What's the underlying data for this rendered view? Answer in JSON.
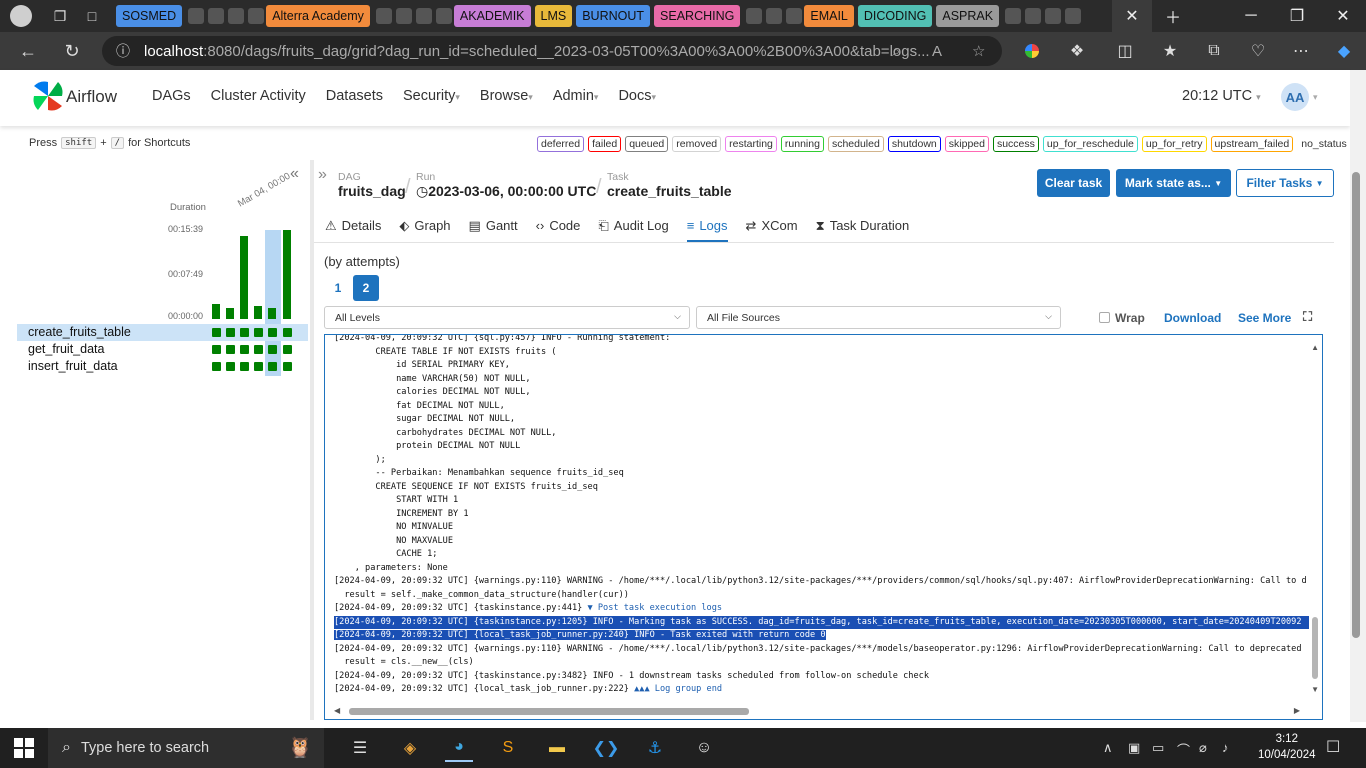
{
  "browser": {
    "bookmarks": [
      {
        "label": "SOSMED",
        "color": "#4a8fe7"
      },
      {
        "label": "Alterra Academy",
        "color": "#f28b3c"
      },
      {
        "label": "AKADEMIK",
        "color": "#c77dd6"
      },
      {
        "label": "LMS",
        "color": "#e8b93a"
      },
      {
        "label": "BURNOUT",
        "color": "#4a8fe7"
      },
      {
        "label": "SEARCHING",
        "color": "#e86aa8"
      },
      {
        "label": "EMAIL",
        "color": "#f28b3c"
      },
      {
        "label": "DICODING",
        "color": "#52c0b4"
      },
      {
        "label": "ASPRAK",
        "color": "#9a9a9a"
      }
    ],
    "url_host": "localhost",
    "url_rest": ":8080/dags/fruits_dag/grid?dag_run_id=scheduled__2023-03-05T00%3A00%3A00%2B00%3A00&tab=logs..."
  },
  "airflow": {
    "brand": "Airflow",
    "menu": [
      {
        "label": "DAGs",
        "dropdown": false
      },
      {
        "label": "Cluster Activity",
        "dropdown": false
      },
      {
        "label": "Datasets",
        "dropdown": false
      },
      {
        "label": "Security",
        "dropdown": true
      },
      {
        "label": "Browse",
        "dropdown": true
      },
      {
        "label": "Admin",
        "dropdown": true
      },
      {
        "label": "Docs",
        "dropdown": true
      }
    ],
    "clock": "20:12 UTC",
    "avatar": "AA",
    "shortcut": {
      "press": "Press",
      "key1": "shift",
      "plus": "+",
      "key2": "/",
      "suffix": "for Shortcuts"
    },
    "legend": [
      {
        "label": "deferred",
        "color": "#9370db"
      },
      {
        "label": "failed",
        "color": "#ff0000"
      },
      {
        "label": "queued",
        "color": "#808080"
      },
      {
        "label": "removed",
        "color": "#d3d3d3"
      },
      {
        "label": "restarting",
        "color": "#ee82ee"
      },
      {
        "label": "running",
        "color": "#32cd32"
      },
      {
        "label": "scheduled",
        "color": "#d2b48c"
      },
      {
        "label": "shutdown",
        "color": "#0000ff"
      },
      {
        "label": "skipped",
        "color": "#ff69b4"
      },
      {
        "label": "success",
        "color": "#008000"
      },
      {
        "label": "up_for_reschedule",
        "color": "#40e0d0"
      },
      {
        "label": "up_for_retry",
        "color": "#ffd700"
      },
      {
        "label": "upstream_failed",
        "color": "#ffa500"
      },
      {
        "label": "no_status",
        "color": "#ffffff"
      }
    ],
    "grid": {
      "duration_label": "Duration",
      "date_label": "Mar 04, 00:00",
      "yticks": [
        "00:15:39",
        "00:07:49",
        "00:00:00"
      ],
      "tasks": [
        "create_fruits_table",
        "get_fruit_data",
        "insert_fruit_data"
      ],
      "selected_task": "create_fruits_table"
    },
    "breadcrumb": {
      "dag_label": "DAG",
      "dag_value": "fruits_dag",
      "run_label": "Run",
      "run_value": "2023-03-06, 00:00:00 UTC",
      "task_label": "Task",
      "task_value": "create_fruits_table"
    },
    "buttons": {
      "clear": "Clear task",
      "mark": "Mark state as...",
      "filter": "Filter Tasks"
    },
    "tabs": [
      {
        "label": "Details",
        "icon": "warning-icon"
      },
      {
        "label": "Graph",
        "icon": "graph-icon"
      },
      {
        "label": "Gantt",
        "icon": "gantt-icon"
      },
      {
        "label": "Code",
        "icon": "code-icon"
      },
      {
        "label": "Audit Log",
        "icon": "audit-icon"
      },
      {
        "label": "Logs",
        "icon": "list-icon",
        "active": true
      },
      {
        "label": "XCom",
        "icon": "exchange-icon"
      },
      {
        "label": "Task Duration",
        "icon": "hourglass-icon"
      }
    ],
    "attempts_label": "(by attempts)",
    "attempts": [
      "1",
      "2"
    ],
    "active_attempt": "2",
    "levels_select": "All Levels",
    "sources_select": "All File Sources",
    "wrap_label": "Wrap",
    "download_label": "Download",
    "see_more_label": "See More",
    "log_lines": [
      {
        "text": "[2024-04-09, 20:09:32 UTC] {sql.py:457} INFO - Running statement:"
      },
      {
        "text": "        CREATE TABLE IF NOT EXISTS fruits ("
      },
      {
        "text": "            id SERIAL PRIMARY KEY,"
      },
      {
        "text": "            name VARCHAR(50) NOT NULL,"
      },
      {
        "text": "            calories DECIMAL NOT NULL,"
      },
      {
        "text": "            fat DECIMAL NOT NULL,"
      },
      {
        "text": "            sugar DECIMAL NOT NULL,"
      },
      {
        "text": "            carbohydrates DECIMAL NOT NULL,"
      },
      {
        "text": "            protein DECIMAL NOT NULL"
      },
      {
        "text": "        );"
      },
      {
        "text": "        -- Perbaikan: Menambahkan sequence fruits_id_seq"
      },
      {
        "text": "        CREATE SEQUENCE IF NOT EXISTS fruits_id_seq"
      },
      {
        "text": "            START WITH 1"
      },
      {
        "text": "            INCREMENT BY 1"
      },
      {
        "text": "            NO MINVALUE"
      },
      {
        "text": "            NO MAXVALUE"
      },
      {
        "text": "            CACHE 1;"
      },
      {
        "text": "    , parameters: None"
      },
      {
        "text": "[2024-04-09, 20:09:32 UTC] {warnings.py:110} WARNING - /home/***/.local/lib/python3.12/site-packages/***/providers/common/sql/hooks/sql.py:407: AirflowProviderDeprecationWarning: Call to d"
      },
      {
        "text": "  result = self._make_common_data_structure(handler(cur))"
      },
      {
        "text": "[2024-04-09, 20:09:32 UTC] {taskinstance.py:441} ",
        "blue": "▼ Post task execution logs"
      },
      {
        "text": "[2024-04-09, 20:09:32 UTC] {taskinstance.py:1205} INFO - Marking task as SUCCESS. dag_id=fruits_dag, task_id=create_fruits_table, execution_date=20230305T000000, start_date=20240409T20092",
        "highlight": "full"
      },
      {
        "text": "[2024-04-09, 20:09:32 UTC] {local_task_job_runner.py:240} INFO - Task exited with return code 0",
        "highlight": "partial"
      },
      {
        "text": "[2024-04-09, 20:09:32 UTC] {warnings.py:110} WARNING - /home/***/.local/lib/python3.12/site-packages/***/models/baseoperator.py:1296: AirflowProviderDeprecationWarning: Call to deprecated"
      },
      {
        "text": "  result = cls.__new__(cls)"
      },
      {
        "text": "[2024-04-09, 20:09:32 UTC] {taskinstance.py:3482} INFO - 1 downstream tasks scheduled from follow-on schedule check"
      },
      {
        "text": "[2024-04-09, 20:09:32 UTC] {local_task_job_runner.py:222} ",
        "blue": "▲▲▲ Log group end"
      }
    ]
  },
  "taskbar": {
    "search_placeholder": "Type here to search",
    "time": "3:12",
    "date": "10/04/2024"
  }
}
